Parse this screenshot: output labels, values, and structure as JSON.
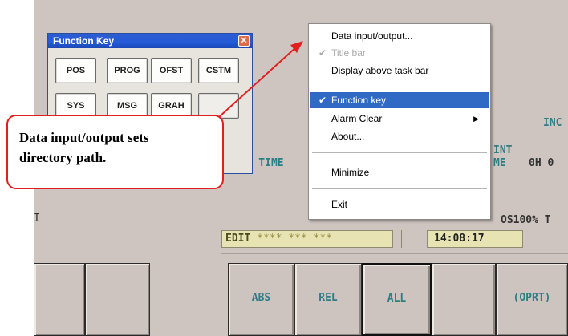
{
  "background": {
    "run_time": "RUN TIME",
    "ome_partial": "ME",
    "hours_partial": "0H 0",
    "int_partial": "INT",
    "inc_partial": "INC",
    "os_partial": "OS100% T",
    "left_bracket": "I"
  },
  "status_bar": {
    "mode": "EDIT",
    "stars": "**** *** ***",
    "time": "14:08:17"
  },
  "softkeys": [
    "",
    "",
    "ABS",
    "REL",
    "ALL",
    "",
    "(OPRT)"
  ],
  "function_key_window": {
    "title": "Function Key",
    "close_glyph": "✕",
    "buttons": [
      "POS",
      "PROG",
      "OFST",
      "CSTM",
      "SYS",
      "MSG",
      "GRAH",
      ""
    ]
  },
  "context_menu": {
    "items": [
      {
        "label": "Data input/output...",
        "checked": false,
        "disabled": false,
        "submenu": false
      },
      {
        "label": "Title bar",
        "checked": true,
        "disabled": true,
        "submenu": false
      },
      {
        "label": "Display above task bar",
        "checked": false,
        "disabled": false,
        "submenu": false
      },
      {
        "label": "Function key",
        "checked": true,
        "disabled": false,
        "submenu": false,
        "selected": true
      },
      {
        "label": "Alarm Clear",
        "checked": false,
        "disabled": false,
        "submenu": true
      },
      {
        "label": "About...",
        "checked": false,
        "disabled": false,
        "submenu": false
      },
      {
        "label": "Minimize",
        "checked": false,
        "disabled": false,
        "submenu": false
      },
      {
        "label": "Exit",
        "checked": false,
        "disabled": false,
        "submenu": false
      }
    ],
    "check_glyph": "✔",
    "arrow_glyph": "▶"
  },
  "callout": {
    "line1": "Data input/output sets",
    "line2": "directory path."
  },
  "colors": {
    "screen_bg": "#cfc5c0",
    "accent_teal": "#2e7e86",
    "menu_highlight": "#316ac5",
    "callout_red": "#e02020"
  }
}
